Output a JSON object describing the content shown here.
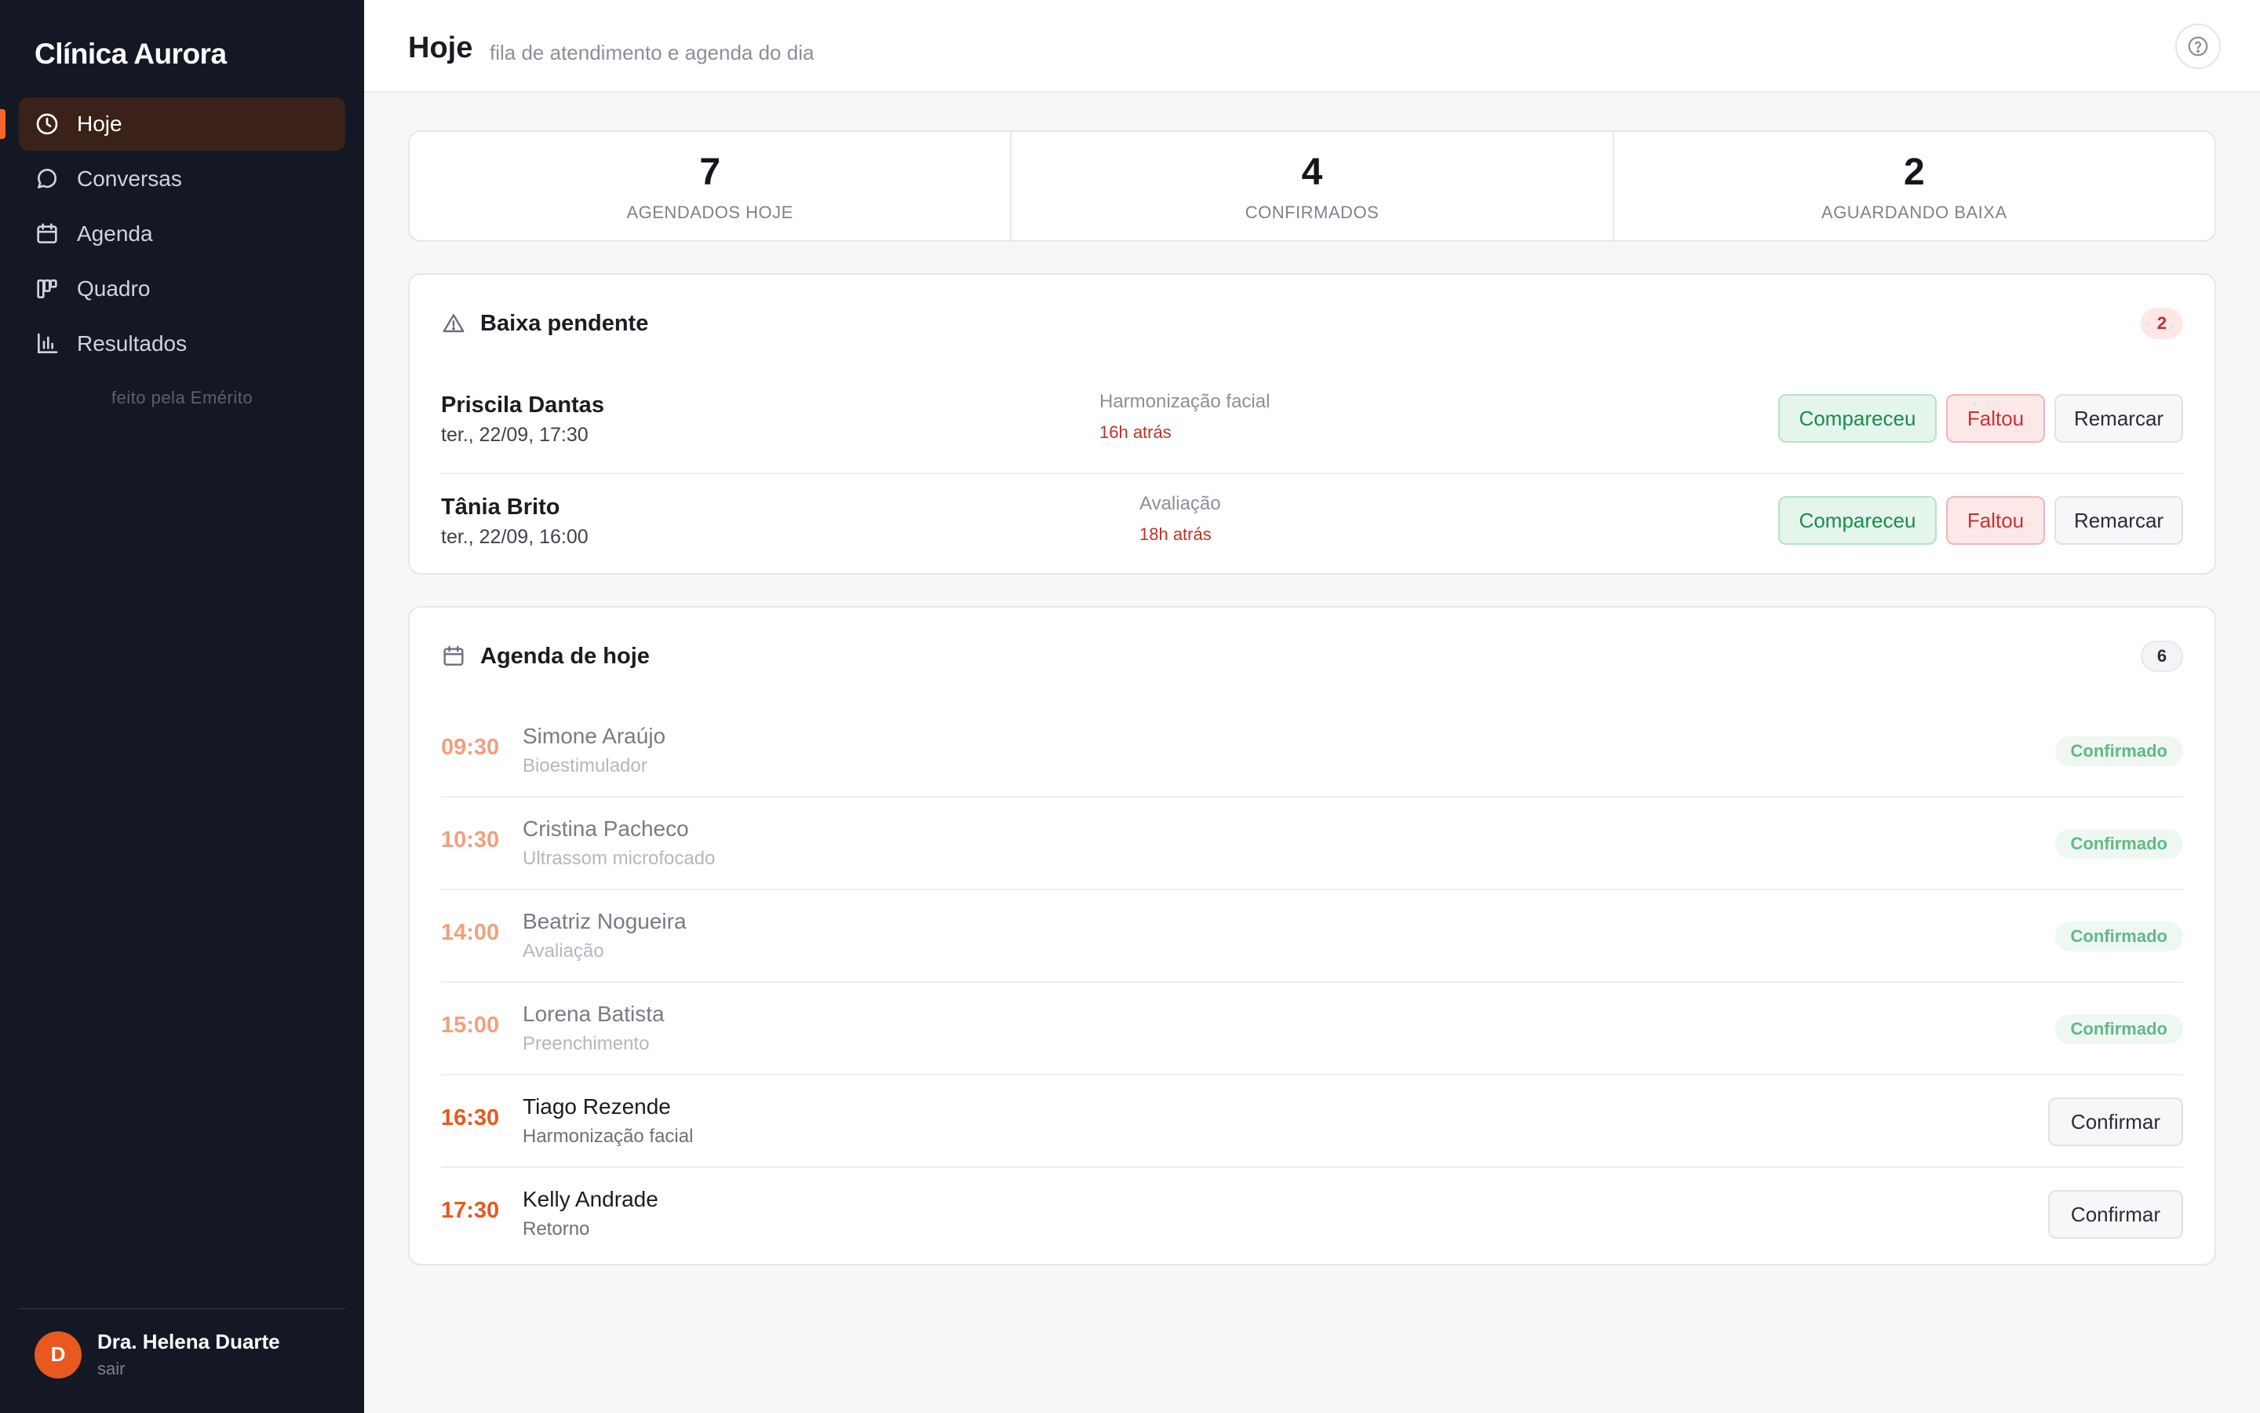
{
  "app": {
    "brand": "Clínica Aurora",
    "made_by": "feito pela Emérito"
  },
  "sidebar": {
    "items": [
      {
        "label": "Hoje",
        "icon": "clock-icon",
        "active": true
      },
      {
        "label": "Conversas",
        "icon": "chat-bubble-icon",
        "active": false
      },
      {
        "label": "Agenda",
        "icon": "calendar-icon",
        "active": false
      },
      {
        "label": "Quadro",
        "icon": "kanban-board-icon",
        "active": false
      },
      {
        "label": "Resultados",
        "icon": "bar-chart-icon",
        "active": false
      }
    ]
  },
  "user": {
    "initial": "D",
    "name": "Dra. Helena Duarte",
    "logout": "sair"
  },
  "header": {
    "title": "Hoje",
    "subtitle": "fila de atendimento e agenda do dia",
    "help_icon": "help-circle-icon"
  },
  "stats": [
    {
      "value": "7",
      "label": "AGENDADOS HOJE"
    },
    {
      "value": "4",
      "label": "CONFIRMADOS"
    },
    {
      "value": "2",
      "label": "AGUARDANDO BAIXA"
    }
  ],
  "pending": {
    "title": "Baixa pendente",
    "icon": "warning-triangle-icon",
    "count": "2",
    "rows": [
      {
        "name": "Priscila Dantas",
        "date": "ter., 22/09, 17:30",
        "procedure": "Harmonização facial",
        "ago": "16h atrás"
      },
      {
        "name": "Tânia Brito",
        "date": "ter., 22/09, 16:00",
        "procedure": "Avaliação",
        "ago": "18h atrás"
      }
    ],
    "actions": {
      "attended": "Compareceu",
      "missed": "Faltou",
      "reschedule": "Remarcar"
    }
  },
  "agenda": {
    "title": "Agenda de hoje",
    "icon": "calendar-icon",
    "count": "6",
    "confirm_label": "Confirmar",
    "rows": [
      {
        "time": "09:30",
        "name": "Simone Araújo",
        "procedure": "Bioestimulador",
        "status": "Confirmado"
      },
      {
        "time": "10:30",
        "name": "Cristina Pacheco",
        "procedure": "Ultrassom microfocado",
        "status": "Confirmado"
      },
      {
        "time": "14:00",
        "name": "Beatriz Nogueira",
        "procedure": "Avaliação",
        "status": "Confirmado"
      },
      {
        "time": "15:00",
        "name": "Lorena Batista",
        "procedure": "Preenchimento",
        "status": "Confirmado"
      },
      {
        "time": "16:30",
        "name": "Tiago Rezende",
        "procedure": "Harmonização facial",
        "status": ""
      },
      {
        "time": "17:30",
        "name": "Kelly Andrade",
        "procedure": "Retorno",
        "status": ""
      }
    ]
  },
  "colors": {
    "accent": "#e8581f",
    "sidebar_bg": "#141824",
    "active_nav_bg": "#3a2219",
    "confirmed_green": "#5fb98a",
    "overdue_red": "#c0322b"
  }
}
